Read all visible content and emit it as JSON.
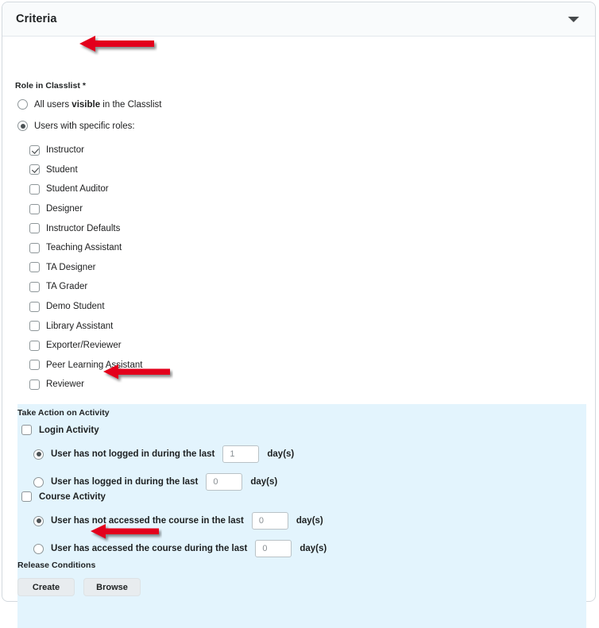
{
  "header": {
    "title": "Criteria",
    "collapse_icon": "chevron-down-icon"
  },
  "role_section": {
    "label": "Role in Classlist *",
    "options": [
      {
        "label_pre": "All users ",
        "label_bold": "visible",
        "label_post": " in the Classlist",
        "selected": false
      },
      {
        "label_pre": "Users with specific roles:",
        "label_bold": "",
        "label_post": "",
        "selected": true
      }
    ],
    "roles": [
      {
        "label": "Instructor",
        "checked": true
      },
      {
        "label": "Student",
        "checked": true
      },
      {
        "label": "Student Auditor",
        "checked": false
      },
      {
        "label": "Designer",
        "checked": false
      },
      {
        "label": "Instructor Defaults",
        "checked": false
      },
      {
        "label": "Teaching Assistant",
        "checked": false
      },
      {
        "label": "TA Designer",
        "checked": false
      },
      {
        "label": "TA Grader",
        "checked": false
      },
      {
        "label": "Demo Student",
        "checked": false
      },
      {
        "label": "Library Assistant",
        "checked": false
      },
      {
        "label": "Exporter/Reviewer",
        "checked": false
      },
      {
        "label": "Peer Learning Assistant",
        "checked": false
      },
      {
        "label": "Reviewer",
        "checked": false
      }
    ]
  },
  "activity_section": {
    "label": "Take Action on Activity",
    "login": {
      "title": "Login Activity",
      "checked": false,
      "options": [
        {
          "text": "User has not logged in during the last",
          "value": "1",
          "unit": "day(s)",
          "selected": true
        },
        {
          "text": "User has logged in during the last",
          "value": "0",
          "unit": "day(s)",
          "selected": false
        }
      ]
    },
    "course": {
      "title": "Course Activity",
      "checked": false,
      "options": [
        {
          "text": "User has not accessed the course in the last",
          "value": "0",
          "unit": "day(s)",
          "selected": true
        },
        {
          "text": "User has accessed the course during the last",
          "value": "0",
          "unit": "day(s)",
          "selected": false
        }
      ]
    }
  },
  "release_section": {
    "label": "Release Conditions",
    "create_label": "Create",
    "browse_label": "Browse"
  },
  "annotations": {
    "arrow_color": "#e3001b",
    "arrows": [
      {
        "name": "arrow-role-in-classlist"
      },
      {
        "name": "arrow-take-action-on-activity"
      },
      {
        "name": "arrow-release-conditions"
      }
    ]
  }
}
